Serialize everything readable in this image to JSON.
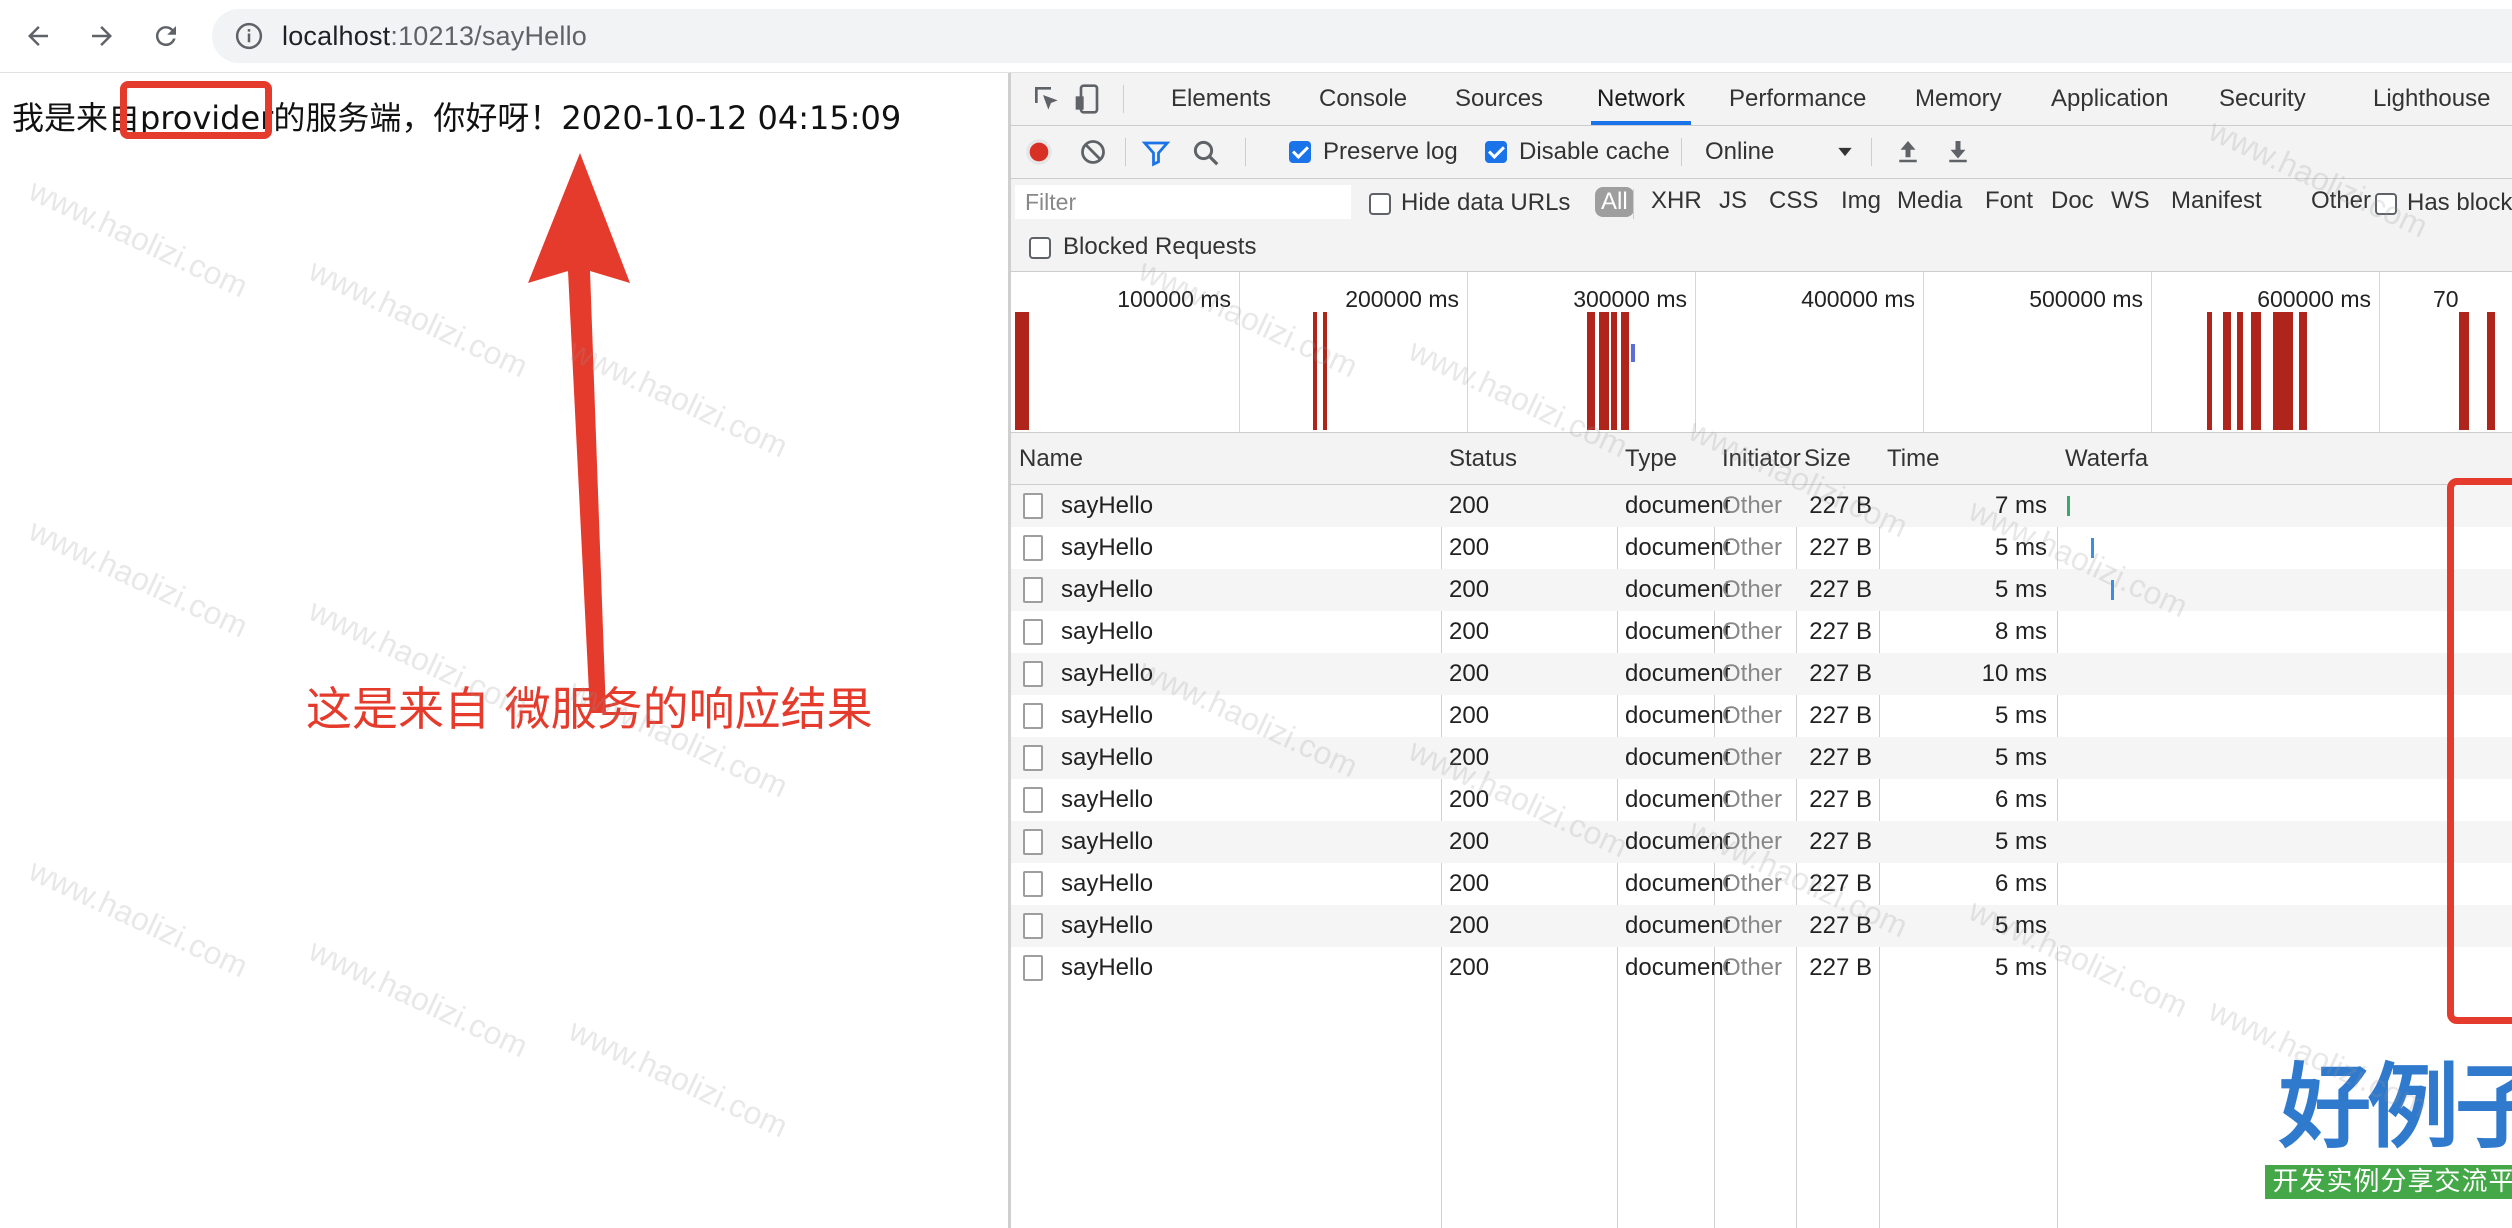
{
  "browser": {
    "url_host": "localhost",
    "url_rest": ":10213/sayHello"
  },
  "page": {
    "response_text": "我是来自provider的服务端，你好呀！2020-10-12 04:15:09",
    "annotation": "这是来自 微服务的响应结果"
  },
  "devtools": {
    "tabs": [
      "Elements",
      "Console",
      "Sources",
      "Network",
      "Performance",
      "Memory",
      "Application",
      "Security",
      "Lighthouse"
    ],
    "active_tab": "Network",
    "preserve_log_label": "Preserve log",
    "preserve_log_checked": true,
    "disable_cache_label": "Disable cache",
    "disable_cache_checked": true,
    "throttle_value": "Online",
    "filter_placeholder": "Filter",
    "hide_data_urls_label": "Hide data URLs",
    "type_filters": [
      "All",
      "XHR",
      "JS",
      "CSS",
      "Img",
      "Media",
      "Font",
      "Doc",
      "WS",
      "Manifest",
      "Other"
    ],
    "has_blocked_label": "Has block",
    "blocked_requests_label": "Blocked Requests",
    "overview_ticks": [
      "100000 ms",
      "200000 ms",
      "300000 ms",
      "400000 ms",
      "500000 ms",
      "600000 ms",
      "70"
    ],
    "columns": [
      "Name",
      "Status",
      "Type",
      "Initiator",
      "Size",
      "Time",
      "Waterfa"
    ],
    "rows": [
      {
        "name": "sayHello",
        "status": "200",
        "type": "document",
        "initiator": "Other",
        "size": "227 B",
        "time": "7 ms"
      },
      {
        "name": "sayHello",
        "status": "200",
        "type": "document",
        "initiator": "Other",
        "size": "227 B",
        "time": "5 ms"
      },
      {
        "name": "sayHello",
        "status": "200",
        "type": "document",
        "initiator": "Other",
        "size": "227 B",
        "time": "5 ms"
      },
      {
        "name": "sayHello",
        "status": "200",
        "type": "document",
        "initiator": "Other",
        "size": "227 B",
        "time": "8 ms"
      },
      {
        "name": "sayHello",
        "status": "200",
        "type": "document",
        "initiator": "Other",
        "size": "227 B",
        "time": "10 ms"
      },
      {
        "name": "sayHello",
        "status": "200",
        "type": "document",
        "initiator": "Other",
        "size": "227 B",
        "time": "5 ms"
      },
      {
        "name": "sayHello",
        "status": "200",
        "type": "document",
        "initiator": "Other",
        "size": "227 B",
        "time": "5 ms"
      },
      {
        "name": "sayHello",
        "status": "200",
        "type": "document",
        "initiator": "Other",
        "size": "227 B",
        "time": "6 ms"
      },
      {
        "name": "sayHello",
        "status": "200",
        "type": "document",
        "initiator": "Other",
        "size": "227 B",
        "time": "5 ms"
      },
      {
        "name": "sayHello",
        "status": "200",
        "type": "document",
        "initiator": "Other",
        "size": "227 B",
        "time": "6 ms"
      },
      {
        "name": "sayHello",
        "status": "200",
        "type": "document",
        "initiator": "Other",
        "size": "227 B",
        "time": "5 ms"
      },
      {
        "name": "sayHello",
        "status": "200",
        "type": "document",
        "initiator": "Other",
        "size": "227 B",
        "time": "5 ms"
      }
    ]
  },
  "watermark": {
    "text": "www.haolizi.com",
    "logo_main": "好例子网",
    "logo_sub": "开发实例分享交流平台"
  },
  "colors": {
    "annotation_red": "#e53b2c",
    "accent_blue": "#1a73e8",
    "timeline_bar": "#b0251b"
  }
}
